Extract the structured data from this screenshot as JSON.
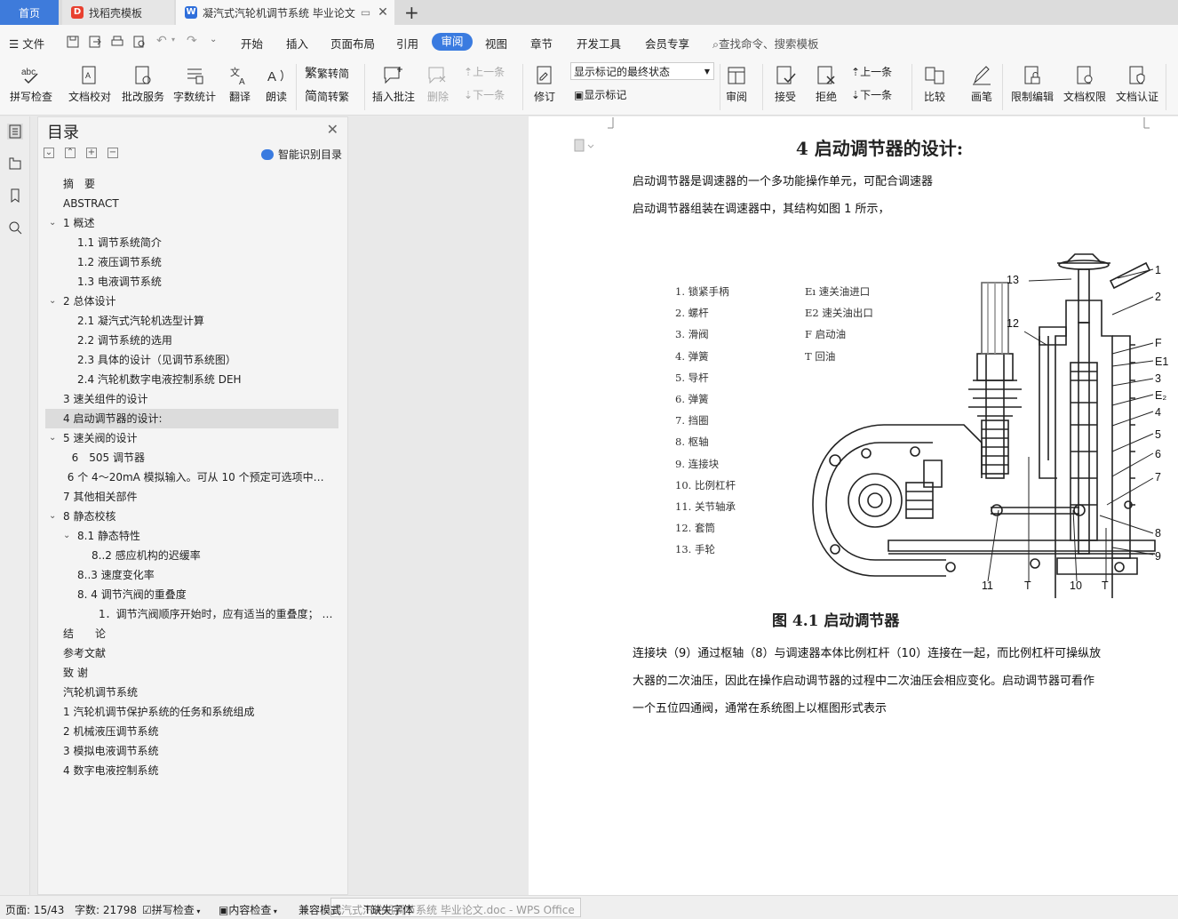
{
  "tabs": {
    "home": "首页",
    "template": "找稻壳模板",
    "doc": "凝汽式汽轮机调节系统 毕业论文"
  },
  "menu": {
    "file": "文件",
    "items": [
      "开始",
      "插入",
      "页面布局",
      "引用",
      "审阅",
      "视图",
      "章节",
      "开发工具",
      "会员专享"
    ],
    "search": "查找命令、搜索模板"
  },
  "ribbon": {
    "spell": "拼写检查",
    "proof": "文档校对",
    "batch": "批改服务",
    "count": "字数统计",
    "translate": "翻译",
    "read": "朗读",
    "trad": "繁转简",
    "simp": "简转繁",
    "insert_comment": "插入批注",
    "delete": "删除",
    "prev": "上一条",
    "next": "下一条",
    "revise": "修订",
    "show_state": "显示标记的最终状态",
    "show_marks": "显示标记",
    "review": "审阅",
    "accept": "接受",
    "reject": "拒绝",
    "prev2": "上一条",
    "next2": "下一条",
    "compare": "比较",
    "pen": "画笔",
    "restrict": "限制编辑",
    "perm": "文档权限",
    "auth": "文档认证"
  },
  "toc": {
    "title": "目录",
    "smart": "智能识别目录",
    "items": [
      {
        "text": "摘　要",
        "level": 1,
        "caret": ""
      },
      {
        "text": "ABSTRACT",
        "level": 1,
        "caret": ""
      },
      {
        "text": "1  概述",
        "level": 1,
        "caret": "v"
      },
      {
        "text": "1.1 调节系统简介",
        "level": 2,
        "caret": ""
      },
      {
        "text": "1.2 液压调节系统",
        "level": 2,
        "caret": ""
      },
      {
        "text": "1.3 电液调节系统",
        "level": 2,
        "caret": ""
      },
      {
        "text": "2  总体设计",
        "level": 1,
        "caret": "v"
      },
      {
        "text": "2.1 凝汽式汽轮机选型计算",
        "level": 2,
        "caret": ""
      },
      {
        "text": "2.2 调节系统的选用",
        "level": 2,
        "caret": ""
      },
      {
        "text": "2.3 具体的设计（见调节系统图）",
        "level": 2,
        "caret": ""
      },
      {
        "text": "2.4 汽轮机数字电液控制系统 DEH",
        "level": 2,
        "caret": ""
      },
      {
        "text": "3 速关组件的设计",
        "level": 1,
        "caret": ""
      },
      {
        "text": "4 启动调节器的设计:",
        "level": 1,
        "caret": "",
        "selected": true
      },
      {
        "text": "5 速关阀的设计",
        "level": 1,
        "caret": "v"
      },
      {
        "text": "6　505 调节器",
        "level": 1.6,
        "caret": ""
      },
      {
        "text": "6 个 4～20mA 模拟输入。可从 10 个预定可选项中选…",
        "level": 1.3,
        "caret": ""
      },
      {
        "text": "7  其他相关部件",
        "level": 1,
        "caret": ""
      },
      {
        "text": "8 静态校核",
        "level": 1,
        "caret": "v"
      },
      {
        "text": "8.1 静态特性",
        "level": 2,
        "caret": "v"
      },
      {
        "text": "8..2 感应机构的迟缓率",
        "level": 3,
        "caret": ""
      },
      {
        "text": "8..3 速度变化率",
        "level": 2,
        "caret": ""
      },
      {
        "text": "8. 4 调节汽阀的重叠度",
        "level": 2,
        "caret": ""
      },
      {
        "text": "1．调节汽阀顺序开始时，应有适当的重叠度；  …",
        "level": 3.5,
        "caret": ""
      },
      {
        "text": "结　　论",
        "level": 1,
        "caret": ""
      },
      {
        "text": "参考文献",
        "level": 1,
        "caret": ""
      },
      {
        "text": "致  谢",
        "level": 1,
        "caret": ""
      },
      {
        "text": "汽轮机调节系统",
        "level": 1,
        "caret": ""
      },
      {
        "text": "1 汽轮机调节保护系统的任务和系统组成",
        "level": 1,
        "caret": ""
      },
      {
        "text": "2 机械液压调节系统",
        "level": 1,
        "caret": ""
      },
      {
        "text": "3 模拟电液调节系统",
        "level": 1,
        "caret": ""
      },
      {
        "text": "4  数字电液控制系统",
        "level": 1,
        "caret": ""
      }
    ]
  },
  "document": {
    "heading": "4 启动调节器的设计:",
    "p1": "启动调节器是调速器的一个多功能操作单元，可配合调速器",
    "p2": "启动调节器组装在调速器中，其结构如图 1 所示，",
    "legend_left": [
      "1.  锁紧手柄",
      "2.  螺杆",
      "3.  滑阀",
      "4.  弹簧",
      "5.  导杆",
      "6.  弹簧",
      "7.  挡圈",
      "8.  枢轴",
      "9.  连接块",
      "10.  比例杠杆",
      "11.  关节轴承",
      "12.  套筒",
      "13.  手轮"
    ],
    "legend_right": [
      "Eı  速关油进口",
      "E2  速关油出口",
      "F    启动油",
      "T    回油"
    ],
    "fig_labels": {
      "l13": "13",
      "l12": "12",
      "l1": "1",
      "l2": "2",
      "lF": "F",
      "lE1": "E1",
      "l3": "3",
      "lE2": "E₂",
      "l4": "4",
      "l5": "5",
      "l6": "6",
      "l7": "7",
      "l8": "8",
      "l9": "9",
      "l11": "11",
      "lT1": "T",
      "l10": "10",
      "lT2": "T"
    },
    "caption": "图 4.1  启动调节器",
    "p3": "连接块（9）通过枢轴（8）与调速器本体比例杠杆（10）连接在一起，而比例杠杆可操纵放",
    "p4": "大器的二次油压，因此在操作启动调节器的过程中二次油压会相应变化。启动调节器可看作",
    "p5": "一个五位四通阀，通常在系统图上以框图形式表示"
  },
  "status": {
    "page": "页面: 15/43",
    "words": "字数: 21798",
    "spell": "拼写检查",
    "content": "内容检查",
    "compat": "兼容模式",
    "font": "缺失字体",
    "ghost": "凝汽式汽轮机调节系统 毕业论文.doc - WPS Office"
  },
  "colors": {
    "accent": "#3a7be0",
    "home_tab": "#3e7bdb",
    "template_logo": "#e8402f"
  }
}
